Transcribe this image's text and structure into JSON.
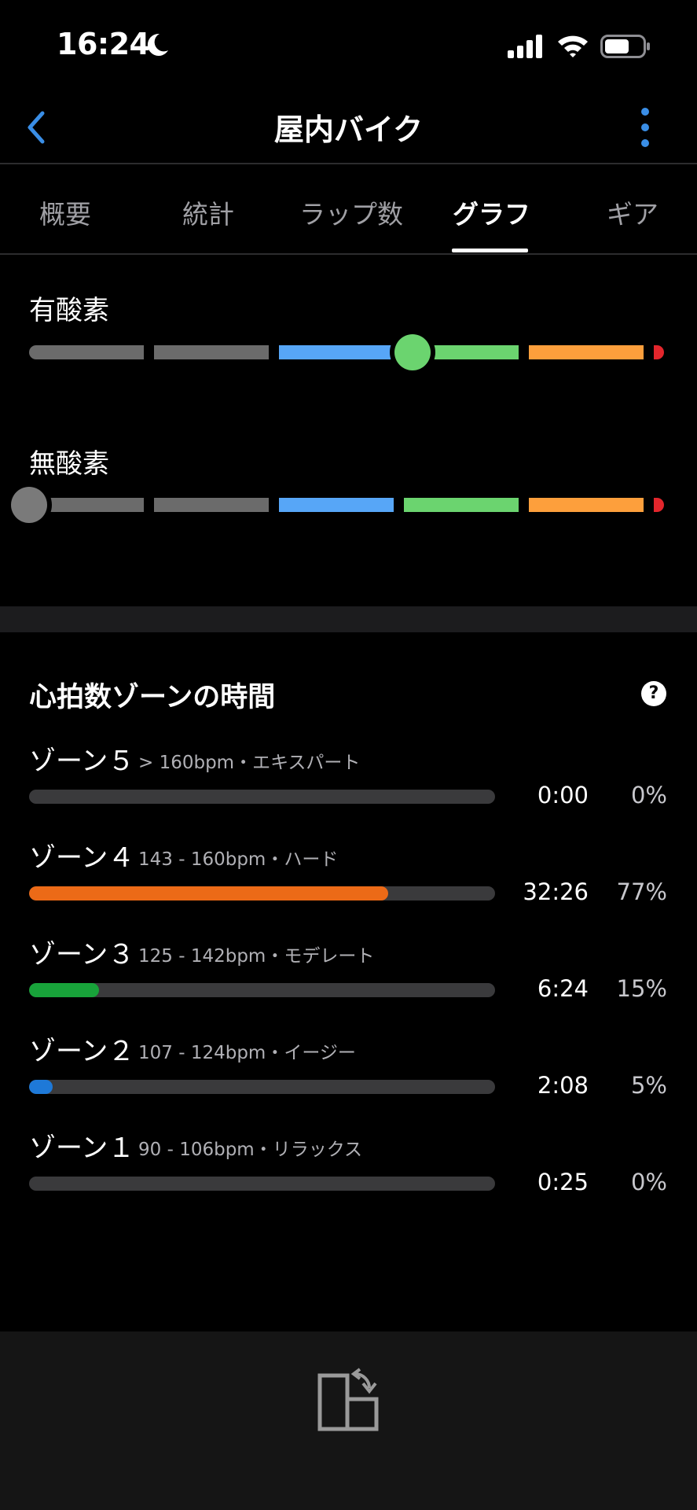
{
  "status_bar": {
    "time": "16:24",
    "icons": [
      "moon-icon",
      "cellular-signal-icon",
      "wifi-icon",
      "battery-icon"
    ]
  },
  "nav": {
    "title": "屋内バイク",
    "back_icon": "chevron-left-icon",
    "more_icon": "vertical-ellipsis-icon",
    "accent_color": "#3a8ee6"
  },
  "tabs": [
    {
      "label": "概要",
      "active": false
    },
    {
      "label": "統計",
      "active": false
    },
    {
      "label": "ラップ数",
      "active": false
    },
    {
      "label": "グラフ",
      "active": true
    },
    {
      "label": "ギア",
      "active": false
    }
  ],
  "training_effect": {
    "segment_colors": [
      "#6b6b6b",
      "#6b6b6b",
      "#57a6f7",
      "#6bd46f",
      "#fd9f3c",
      "#e3262c"
    ],
    "aerobic": {
      "label": "有酸素",
      "knob_color": "#6bd46f",
      "level_fraction": 0.604
    },
    "anaerobic": {
      "label": "無酸素",
      "knob_color": "#7a7a7a",
      "level_fraction": 0.0
    }
  },
  "hr_zones": {
    "title": "心拍数ゾーンの時間",
    "help_icon": "question-circle-icon",
    "help_label": "?",
    "zones": [
      {
        "name": "ゾーン５",
        "range": "> 160bpm・エキスパート",
        "time": "0:00",
        "percent": "0%",
        "fill_fraction": 0.0,
        "color": "#e9661b"
      },
      {
        "name": "ゾーン４",
        "range": "143 - 160bpm・ハード",
        "time": "32:26",
        "percent": "77%",
        "fill_fraction": 0.77,
        "color": "#ec6a17"
      },
      {
        "name": "ゾーン３",
        "range": "125 - 142bpm・モデレート",
        "time": "6:24",
        "percent": "15%",
        "fill_fraction": 0.15,
        "color": "#18a33a"
      },
      {
        "name": "ゾーン２",
        "range": "107 - 124bpm・イージー",
        "time": "2:08",
        "percent": "5%",
        "fill_fraction": 0.05,
        "color": "#1e79d8"
      },
      {
        "name": "ゾーン１",
        "range": "90 - 106bpm・リラックス",
        "time": "0:25",
        "percent": "0%",
        "fill_fraction": 0.0,
        "color": "#8e8e93"
      }
    ]
  },
  "bottom_bar": {
    "icon": "rotate-screen-icon"
  }
}
